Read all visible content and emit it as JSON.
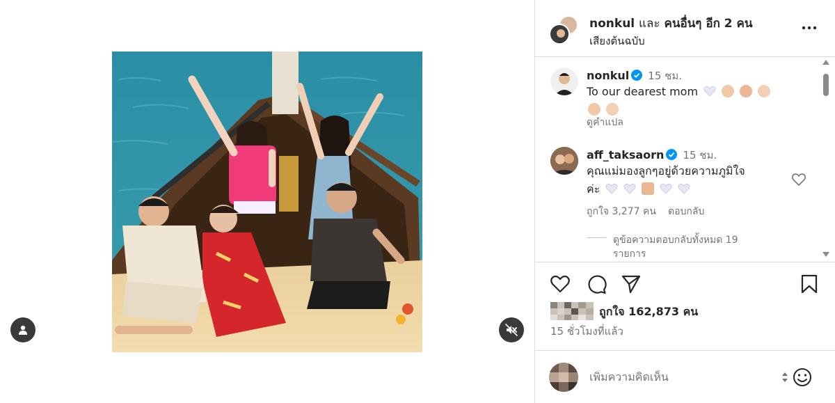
{
  "header": {
    "user": "nonkul",
    "and_text": "และ",
    "others": "คนอื่นๆ อีก 2 คน",
    "audio": "เสียงต้นฉบับ"
  },
  "comments": [
    {
      "user": "nonkul",
      "time": "15 ชม.",
      "text": "To our dearest mom",
      "translate": "ดูคำแปล"
    },
    {
      "user": "aff_taksaorn",
      "time": "15 ชม.",
      "text_line1": "คุณแม่มองลูกๆอยู่ด้วยความภูมิใจ",
      "text_line2": "ค่ะ",
      "likes": "ถูกใจ 3,277 คน",
      "reply": "ตอบกลับ",
      "view_replies_line1": "ดูข้อความตอบกลับทั้งหมด 19",
      "view_replies_line2": "รายการ"
    }
  ],
  "likes_text": "ถูกใจ 162,873 คน",
  "time_ago": "15 ชั่วโมงที่แล้ว",
  "comment_placeholder": "เพิ่มความคิดเห็น",
  "colors": {
    "verified": "#0095f6",
    "text": "#262626",
    "muted": "#737373",
    "border": "#dbdbdb",
    "sea": "#2f8fa2"
  },
  "icons": [
    "person-icon",
    "mute-icon",
    "more-icon",
    "verified-icon",
    "heart-icon",
    "comment-icon",
    "share-icon",
    "bookmark-icon",
    "smile-icon"
  ]
}
